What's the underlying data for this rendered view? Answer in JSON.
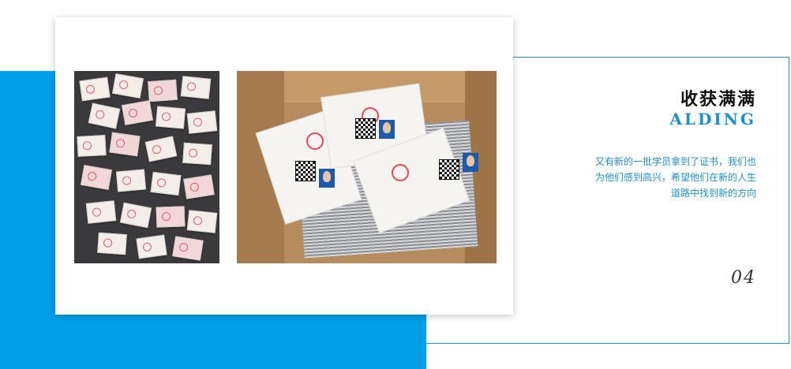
{
  "section": {
    "title": "收获满满",
    "subtitle": "ALDING",
    "description_lines": [
      "又有新的一批学员拿到了证书，我们也",
      "为他们感到高兴，希望他们在新的人生",
      "道路中找到新的方向"
    ],
    "page_number": "04"
  },
  "colors": {
    "accent_blue": "#00a0e9",
    "frame_blue": "#1f8fc9"
  }
}
